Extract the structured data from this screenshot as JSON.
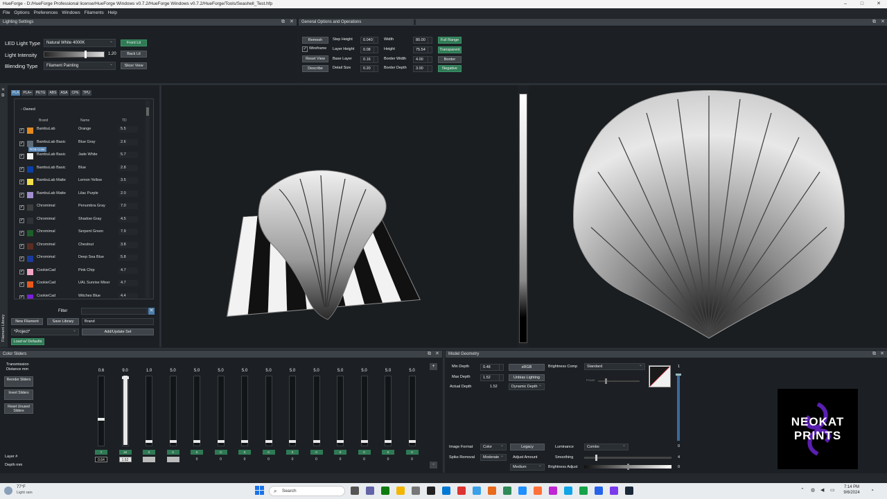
{
  "window": {
    "title": "HueForge - D:/HueForge Professional license/HueForge Windows v0.7.2/HueForge Windows v0.7.2/HueForge/Tools/Seashell_Test.hfp"
  },
  "menu": [
    "File",
    "Options",
    "Preferences",
    "Windows",
    "Filaments",
    "Help"
  ],
  "lighting": {
    "panel_title": "Lighting Settings",
    "led_label": "LED Light Type",
    "led_value": "Natural White 4000K",
    "front_btn": "Front Lit",
    "intensity_label": "Light Intensity",
    "intensity_value": "1.20",
    "back_btn": "Back Lit",
    "blend_label": "Blending Type",
    "blend_value": "Filament Painting",
    "slicer_btn": "Slicer View"
  },
  "general": {
    "panel_title": "General Options and Operations",
    "remesh": "Remesh",
    "wireframe": "Wireframe",
    "reset_view": "Reset View",
    "describe": "Describe",
    "step_height_l": "Step Height",
    "step_height": "0.040",
    "layer_height_l": "Layer Height",
    "layer_height": "0.08",
    "base_layer_l": "Base Layer",
    "base_layer": "0.16",
    "detail_size_l": "Detail Size",
    "detail_size": "0.20",
    "width_l": "Width",
    "width": "80.00",
    "height_l": "Height",
    "height": "75.54",
    "border_width_l": "Border Width",
    "border_width": "4.00",
    "border_depth_l": "Border Depth",
    "border_depth": "3.00",
    "full_range": "Full Range",
    "transparent": "Transparent",
    "border": "Border",
    "negative": "Negative"
  },
  "library": {
    "tabs": [
      "PLA",
      "PLA+",
      "PETG",
      "ABS",
      "ASA",
      "CPE",
      "TPU"
    ],
    "group": "- Owned",
    "col_brand": "Brand",
    "col_name": "Name",
    "col_td": "TD",
    "tooltip": "RGB Color",
    "side_label": "Filament Library",
    "rows": [
      {
        "brand": "BambuLab",
        "name": "Orange",
        "td": "5.5",
        "color": "#e58a1f"
      },
      {
        "brand": "BambuLab Basic",
        "name": "Blue Gray",
        "td": "2.6",
        "color": "#5d6a78"
      },
      {
        "brand": "BambuLab Basic",
        "name": "Jade White",
        "td": "5.7",
        "color": "#f4f4f2"
      },
      {
        "brand": "BambuLab Basic",
        "name": "Blue",
        "td": "2.8",
        "color": "#0b3fa6"
      },
      {
        "brand": "BambuLab Matte",
        "name": "Lemon Yellow",
        "td": "3.5",
        "color": "#f2e04a"
      },
      {
        "brand": "BambuLab Matte",
        "name": "Lilac Purple",
        "td": "2.0",
        "color": "#a38fd0"
      },
      {
        "brand": "Chromimal",
        "name": "Penumbra Gray",
        "td": "7.0",
        "color": "#3d3d3d"
      },
      {
        "brand": "Chromimal",
        "name": "Shadow Gray",
        "td": "4.5",
        "color": "#2f3336"
      },
      {
        "brand": "Chromimal",
        "name": "Serpent Green",
        "td": "7.9",
        "color": "#1e5e2a"
      },
      {
        "brand": "Chromimal",
        "name": "Chestnut",
        "td": "3.8",
        "color": "#5a2e22"
      },
      {
        "brand": "Chromimal",
        "name": "Deep Sea Blue",
        "td": "5.8",
        "color": "#1b3a9c"
      },
      {
        "brand": "CookieCad",
        "name": "Pink Chip",
        "td": "4.7",
        "color": "#f2a6c6"
      },
      {
        "brand": "CookieCad",
        "name": "UAL Sunrise Mixer",
        "td": "4.7",
        "color": "#e8591a"
      },
      {
        "brand": "CookieCad",
        "name": "Witches Blue",
        "td": "4.4",
        "color": "#7a1fd6"
      }
    ],
    "filter_label": "Filter",
    "new_btn": "New Filament",
    "save_btn": "Save Library",
    "brand_field": "Brand",
    "project_value": "*Project*",
    "add_update_btn": "Add/Update Set",
    "load_defaults_btn": "Load w/ Defaults"
  },
  "color_sliders": {
    "panel_title": "Color Sliders",
    "transmission_label": "Transmission Distance mm",
    "reorder_btn": "Reorder Sliders",
    "invert_btn": "Invert Sliders",
    "reset_btn": "Reset Unused Sliders",
    "layer_label": "Layer #",
    "depth_label": "Depth mm",
    "sliders": [
      {
        "value": "0.6",
        "layer": "7",
        "depth": "0.64",
        "level": 0.38
      },
      {
        "value": "9.0",
        "layer": "18",
        "depth": "1.52",
        "level": 1.0
      },
      {
        "value": "1.0",
        "layer": "0",
        "depth": "0",
        "level": 0.04
      },
      {
        "value": "5.0",
        "layer": "0",
        "depth": "0",
        "level": 0.04
      },
      {
        "value": "5.0",
        "layer": "0",
        "depth": "0",
        "level": 0.04
      },
      {
        "value": "5.0",
        "layer": "0",
        "depth": "0",
        "level": 0.04
      },
      {
        "value": "5.0",
        "layer": "0",
        "depth": "0",
        "level": 0.04
      },
      {
        "value": "5.0",
        "layer": "0",
        "depth": "0",
        "level": 0.04
      },
      {
        "value": "5.0",
        "layer": "0",
        "depth": "0",
        "level": 0.04
      },
      {
        "value": "5.0",
        "layer": "0",
        "depth": "0",
        "level": 0.04
      },
      {
        "value": "5.0",
        "layer": "0",
        "depth": "0",
        "level": 0.04
      },
      {
        "value": "5.0",
        "layer": "0",
        "depth": "0",
        "level": 0.04
      },
      {
        "value": "5.0",
        "layer": "0",
        "depth": "0",
        "level": 0.04
      },
      {
        "value": "5.0",
        "layer": "0",
        "depth": "0",
        "level": 0.04
      }
    ],
    "plus": "+",
    "minus": "-"
  },
  "geometry": {
    "panel_title": "Model Geometry",
    "min_depth_l": "Min Depth",
    "min_depth": "0.48",
    "max_depth_l": "Max Depth",
    "max_depth": "1.52",
    "actual_depth_l": "Actual Depth",
    "actual_depth": "1.52",
    "srgb": "sRGB",
    "unbias": "Unbias Lighting",
    "dynamic": "Dynamic Depth",
    "brightness_comp_l": "Brightness Comp",
    "brightness_comp": "Standard",
    "power_l": "Power",
    "image_format_l": "Image Format",
    "image_format": "Color",
    "legacy": "Legacy",
    "spike_l": "Spike Removal",
    "spike": "Moderate",
    "adjust_amount": "Adjust Amount",
    "medium": "Medium",
    "luminance_l": "Luminance",
    "luminance": "Combo",
    "smoothing_l": "Smoothing",
    "smoothing_val": "4",
    "brightness_adj_l": "Brightness Adjust",
    "brightness_adj_val": "0",
    "num_one": "1",
    "num_zero": "0"
  },
  "watermark": {
    "line1": "NEOKAT",
    "line2": "PRINTS"
  },
  "taskbar": {
    "weather_temp": "77°F",
    "weather_desc": "Light rain",
    "search": "Search",
    "time": "7:14 PM",
    "date": "9/6/2024"
  },
  "colors": {
    "accent_green": "#2f7a55",
    "panel_bg": "#1c2024",
    "title_bg": "#3c4248"
  }
}
